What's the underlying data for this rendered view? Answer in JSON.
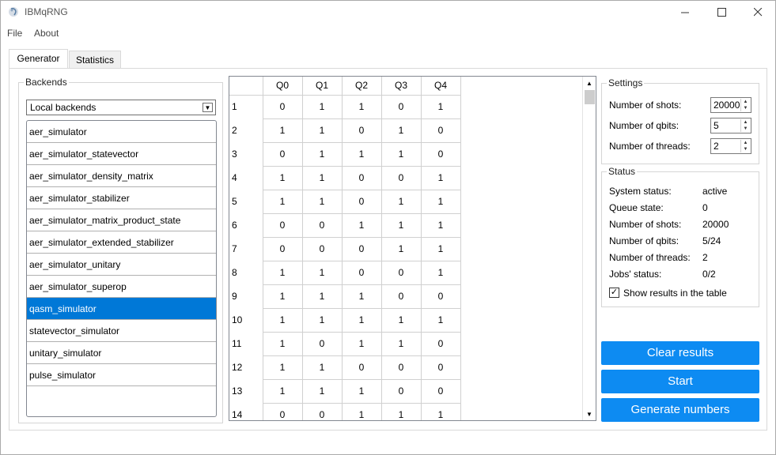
{
  "window": {
    "title": "IBMqRNG",
    "minimize_glyph": "—",
    "maximize_glyph": "☐",
    "close_glyph": "✕"
  },
  "menu": [
    "File",
    "About"
  ],
  "tabs": [
    {
      "label": "Generator",
      "active": true
    },
    {
      "label": "Statistics",
      "active": false
    }
  ],
  "backends": {
    "title": "Backends",
    "dropdown_value": "Local backends",
    "items": [
      "aer_simulator",
      "aer_simulator_statevector",
      "aer_simulator_density_matrix",
      "aer_simulator_stabilizer",
      "aer_simulator_matrix_product_state",
      "aer_simulator_extended_stabilizer",
      "aer_simulator_unitary",
      "aer_simulator_superop",
      "qasm_simulator",
      "statevector_simulator",
      "unitary_simulator",
      "pulse_simulator"
    ],
    "selected_index": 8
  },
  "results_table": {
    "columns": [
      "Q0",
      "Q1",
      "Q2",
      "Q3",
      "Q4"
    ],
    "rows": [
      {
        "label": "1",
        "values": [
          "0",
          "1",
          "1",
          "0",
          "1"
        ]
      },
      {
        "label": "2",
        "values": [
          "1",
          "1",
          "0",
          "1",
          "0"
        ]
      },
      {
        "label": "3",
        "values": [
          "0",
          "1",
          "1",
          "1",
          "0"
        ]
      },
      {
        "label": "4",
        "values": [
          "1",
          "1",
          "0",
          "0",
          "1"
        ]
      },
      {
        "label": "5",
        "values": [
          "1",
          "1",
          "0",
          "1",
          "1"
        ]
      },
      {
        "label": "6",
        "values": [
          "0",
          "0",
          "1",
          "1",
          "1"
        ]
      },
      {
        "label": "7",
        "values": [
          "0",
          "0",
          "0",
          "1",
          "1"
        ]
      },
      {
        "label": "8",
        "values": [
          "1",
          "1",
          "0",
          "0",
          "1"
        ]
      },
      {
        "label": "9",
        "values": [
          "1",
          "1",
          "1",
          "0",
          "0"
        ]
      },
      {
        "label": "10",
        "values": [
          "1",
          "1",
          "1",
          "1",
          "1"
        ]
      },
      {
        "label": "11",
        "values": [
          "1",
          "0",
          "1",
          "1",
          "0"
        ]
      },
      {
        "label": "12",
        "values": [
          "1",
          "1",
          "0",
          "0",
          "0"
        ]
      },
      {
        "label": "13",
        "values": [
          "1",
          "1",
          "1",
          "0",
          "0"
        ]
      },
      {
        "label": "14",
        "values": [
          "0",
          "0",
          "1",
          "1",
          "1"
        ]
      }
    ]
  },
  "settings": {
    "title": "Settings",
    "shots_label": "Number of shots:",
    "shots_value": "20000",
    "qbits_label": "Number of qbits:",
    "qbits_value": "5",
    "threads_label": "Number of threads:",
    "threads_value": "2"
  },
  "status": {
    "title": "Status",
    "rows": [
      {
        "label": "System status:",
        "value": "active"
      },
      {
        "label": "Queue state:",
        "value": "0"
      },
      {
        "label": "Number of shots:",
        "value": "20000"
      },
      {
        "label": "Number of qbits:",
        "value": "5/24"
      },
      {
        "label": "Number of threads:",
        "value": "2"
      },
      {
        "label": "Jobs' status:",
        "value": "0/2"
      }
    ],
    "show_results_label": "Show results in the table",
    "show_results_checked": true
  },
  "actions": {
    "clear": "Clear results",
    "start": "Start",
    "generate": "Generate numbers"
  },
  "colors": {
    "accent": "#0d8bf2",
    "selection": "#0078d7"
  }
}
